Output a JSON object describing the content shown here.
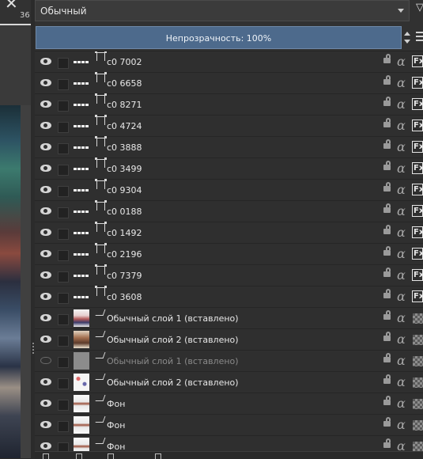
{
  "canvas": {
    "close_glyph": "✕",
    "ruler_value": "36"
  },
  "blend_mode": {
    "value": "Обычный"
  },
  "filter_icon": "filter-icon",
  "opacity": {
    "label": "Непрозрачность:  100%"
  },
  "layers": [
    {
      "name": "c0 7002",
      "type": "vector",
      "visible": true
    },
    {
      "name": "c0 6658",
      "type": "vector",
      "visible": true
    },
    {
      "name": "c0 8271",
      "type": "vector",
      "visible": true
    },
    {
      "name": "c0 4724",
      "type": "vector",
      "visible": true
    },
    {
      "name": "c0 3888",
      "type": "vector",
      "visible": true
    },
    {
      "name": "c0 3499",
      "type": "vector",
      "visible": true
    },
    {
      "name": "c0 9304",
      "type": "vector",
      "visible": true
    },
    {
      "name": "c0 0188",
      "type": "vector",
      "visible": true
    },
    {
      "name": "c0 1492",
      "type": "vector",
      "visible": true
    },
    {
      "name": "c0 2196",
      "type": "vector",
      "visible": true
    },
    {
      "name": "c0 7379",
      "type": "vector",
      "visible": true
    },
    {
      "name": "c0 3608",
      "type": "vector",
      "visible": true
    },
    {
      "name": "Обычный слой 1 (вставлено)",
      "type": "paint",
      "visible": true,
      "thumb": "a"
    },
    {
      "name": "Обычный слой 2 (вставлено)",
      "type": "paint",
      "visible": true,
      "thumb": "b"
    },
    {
      "name": "Обычный слой 1 (вставлено)",
      "type": "paint",
      "visible": false,
      "thumb": "c"
    },
    {
      "name": "Обычный слой 2 (вставлено)",
      "type": "paint",
      "visible": true,
      "thumb": "d"
    },
    {
      "name": "Фон",
      "type": "paint",
      "visible": true,
      "thumb": "e"
    },
    {
      "name": "Фон",
      "type": "paint",
      "visible": true,
      "thumb": "e"
    },
    {
      "name": "Фон",
      "type": "paint",
      "visible": true,
      "thumb": "e"
    }
  ],
  "icons": {
    "alpha_glyph": "α",
    "fx_label": "Fx"
  }
}
